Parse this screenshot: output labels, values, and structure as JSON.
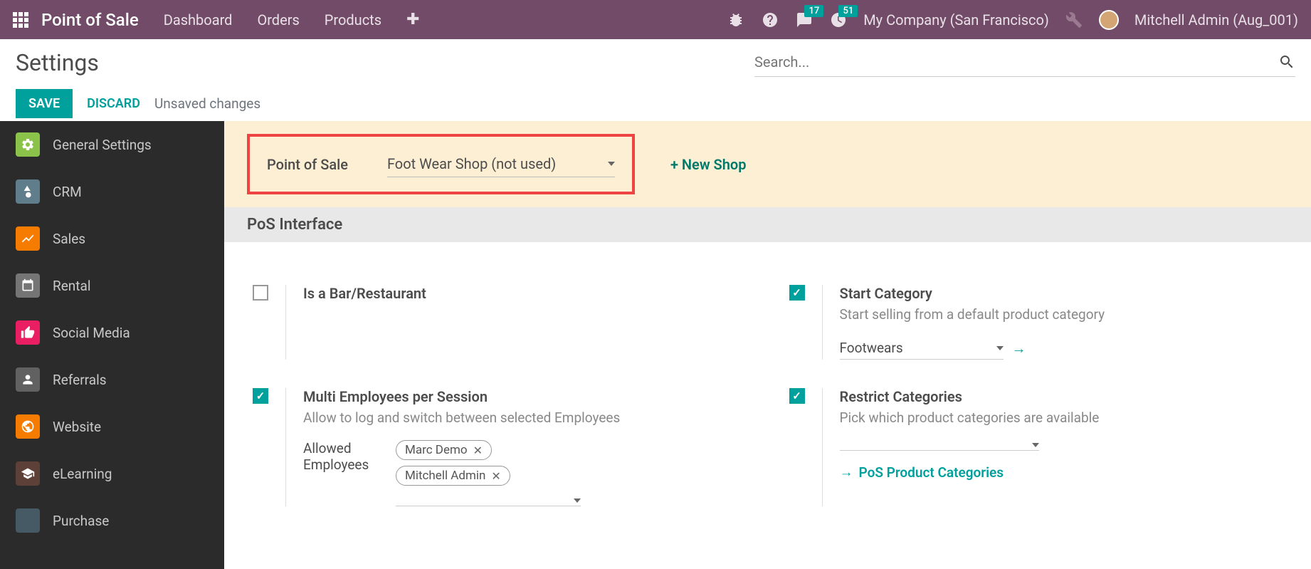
{
  "topbar": {
    "brand": "Point of Sale",
    "nav": [
      "Dashboard",
      "Orders",
      "Products"
    ],
    "messages_badge": "17",
    "activities_badge": "51",
    "company": "My Company (San Francisco)",
    "user": "Mitchell Admin (Aug_001)"
  },
  "subheader": {
    "title": "Settings",
    "search_placeholder": "Search..."
  },
  "actions": {
    "save": "SAVE",
    "discard": "DISCARD",
    "unsaved": "Unsaved changes"
  },
  "sidebar": {
    "items": [
      {
        "label": "General Settings",
        "color": "#8bc34a"
      },
      {
        "label": "CRM",
        "color": "#607d8b"
      },
      {
        "label": "Sales",
        "color": "#f57c00"
      },
      {
        "label": "Rental",
        "color": "#757575"
      },
      {
        "label": "Social Media",
        "color": "#e91e63"
      },
      {
        "label": "Referrals",
        "color": "#616161"
      },
      {
        "label": "Website",
        "color": "#f57c00"
      },
      {
        "label": "eLearning",
        "color": "#5d4037"
      },
      {
        "label": "Purchase",
        "color": "#455a64"
      }
    ]
  },
  "pos_bar": {
    "label": "Point of Sale",
    "selected": "Foot Wear Shop (not used)",
    "new_shop": "+ New Shop"
  },
  "section_title": "PoS Interface",
  "settings": {
    "bar_restaurant": {
      "title": "Is a Bar/Restaurant",
      "checked": false
    },
    "start_category": {
      "title": "Start Category",
      "desc": "Start selling from a default product category",
      "checked": true,
      "value": "Footwears"
    },
    "multi_employees": {
      "title": "Multi Employees per Session",
      "desc": "Allow to log and switch between selected Employees",
      "checked": true,
      "sub_label": "Allowed Employees",
      "tags": [
        "Marc Demo",
        "Mitchell Admin"
      ]
    },
    "restrict_categories": {
      "title": "Restrict Categories",
      "desc": "Pick which product categories are available",
      "checked": true,
      "link": "PoS Product Categories"
    }
  }
}
